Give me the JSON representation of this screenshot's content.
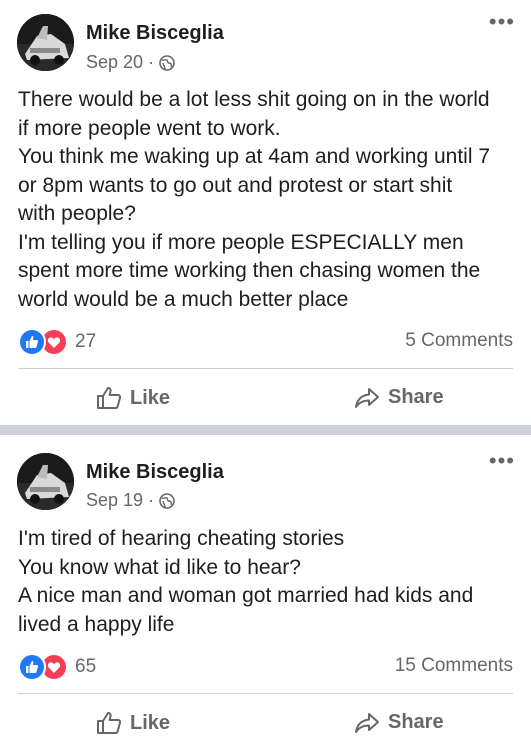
{
  "posts": [
    {
      "author": "Mike Bisceglia",
      "date": "Sep 20",
      "separator": "·",
      "privacy_icon": "globe-icon",
      "more_label": "•••",
      "text_lines": [
        "There would be a lot less shit going on in the world",
        "if more people went to work.",
        "You think me waking up at 4am and working until 7",
        "or 8pm wants to go out and protest or start shit",
        "with people?",
        "I'm telling you if more people ESPECIALLY men",
        "spent more time working then chasing women the",
        "world would be a much better place"
      ],
      "reaction_count": "27",
      "comments": "5 Comments",
      "like_label": "Like",
      "share_label": "Share"
    },
    {
      "author": "Mike Bisceglia",
      "date": "Sep 19",
      "separator": "·",
      "privacy_icon": "globe-icon",
      "more_label": "•••",
      "text_lines": [
        "I'm tired of hearing cheating stories",
        "You know what id like to hear?",
        "A nice man and woman got married had kids and",
        "lived a happy life"
      ],
      "reaction_count": "65",
      "comments": "15 Comments",
      "like_label": "Like",
      "share_label": "Share"
    }
  ],
  "colors": {
    "like_blue": "#2078f4",
    "love_red": "#f33e58",
    "secondary_text": "#65676b",
    "separator": "#cdd0d4"
  }
}
